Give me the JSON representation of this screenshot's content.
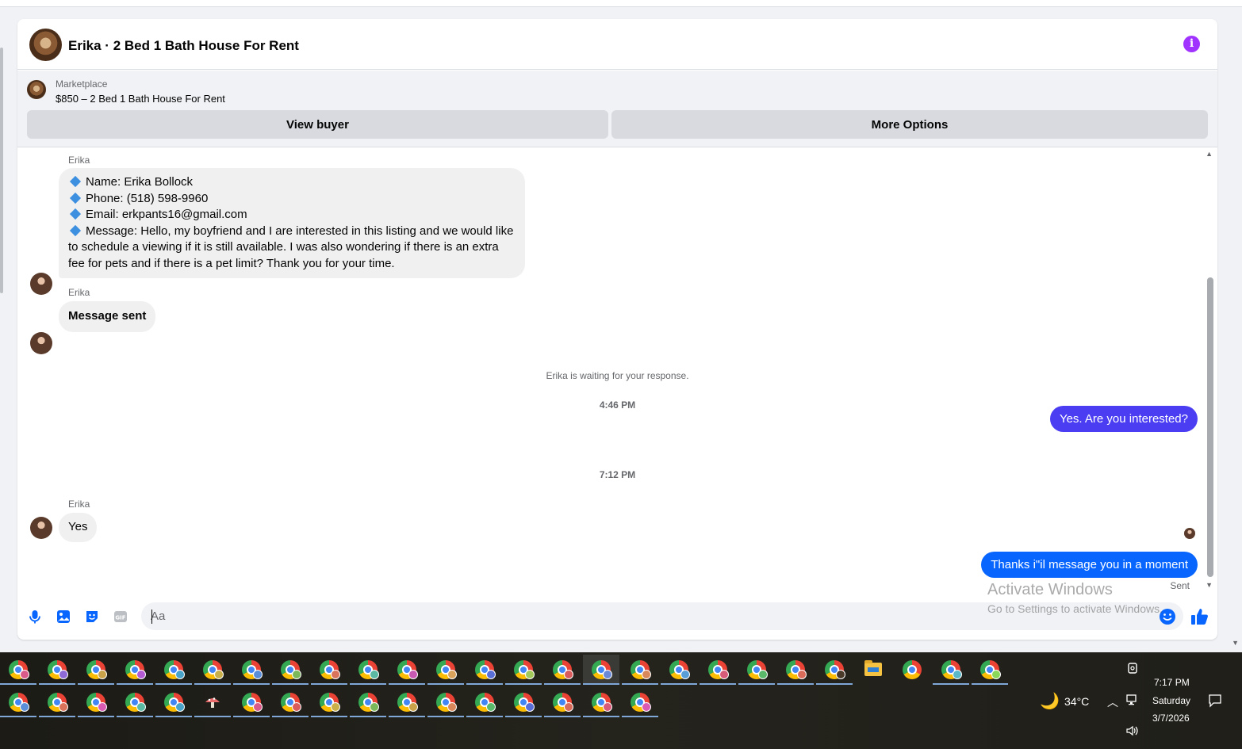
{
  "chat": {
    "header_title": "Erika · 2 Bed 1 Bath House For Rent",
    "listing": {
      "source": "Marketplace",
      "title": "$850 – 2 Bed 1 Bath House For Rent",
      "view_buyer_label": "View buyer",
      "more_options_label": "More Options"
    },
    "messages": {
      "sender_1": "Erika",
      "details": {
        "name_line": "Name: Erika Bollock",
        "phone_line": "Phone: (518) 598-9960",
        "email_line": "Email: erkpants16@gmail.com",
        "message_line": "Message: Hello, my boyfriend and I are interested in this listing and we would like to schedule a viewing if it is still available. I was also wondering if there is an extra fee for pets and if there is a pet limit? Thank you for your time."
      },
      "sender_2": "Erika",
      "message_sent": "Message sent",
      "waiting_note": "Erika is waiting for your response.",
      "time_1": "4:46 PM",
      "reply_1": "Yes. Are you interested?",
      "time_2": "7:12 PM",
      "sender_3": "Erika",
      "yes": "Yes",
      "reply_2": "Thanks i\"il message you in a moment",
      "status": "Sent"
    },
    "composer": {
      "placeholder": "Aa"
    },
    "colors": {
      "outgoing_bubble": "#0866ff",
      "outgoing_bubble_alt": "#4b3df2",
      "accent": "#0866ff",
      "info": "#a033ff"
    }
  },
  "watermark": {
    "title": "Activate Windows",
    "subtitle": "Go to Settings to activate Windows."
  },
  "taskbar": {
    "weather_temp": "34°C",
    "clock_time": "7:17 PM",
    "clock_day": "Saturday",
    "clock_date": "3/7/2026"
  }
}
